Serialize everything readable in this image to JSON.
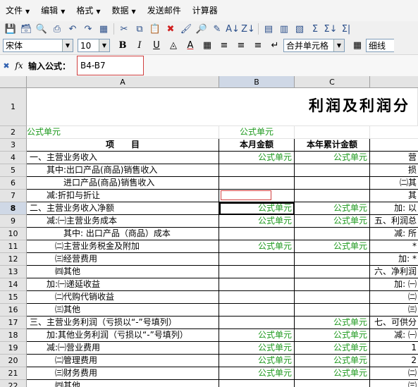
{
  "menubar": {
    "items": [
      {
        "label": "文件",
        "dropdown": true
      },
      {
        "label": "编辑",
        "dropdown": true
      },
      {
        "label": "格式",
        "dropdown": true
      },
      {
        "label": "数据",
        "dropdown": true
      },
      {
        "label": "发送邮件",
        "dropdown": false
      },
      {
        "label": "计算器",
        "dropdown": false
      }
    ]
  },
  "format": {
    "font": "宋体",
    "size": "10",
    "merge": "合并单元格",
    "border": "细线"
  },
  "formula": {
    "label": "输入公式：",
    "value": "B4-B7"
  },
  "grid": {
    "columns": [
      "A",
      "B",
      "C"
    ],
    "title": "利润及利润分",
    "rows": [
      {
        "n": "1",
        "a": "",
        "b": "",
        "c": "",
        "d": ""
      },
      {
        "n": "2",
        "a": "公式单元",
        "b": "公式单元",
        "c": "",
        "d": ""
      },
      {
        "n": "3",
        "a": "项　　目",
        "b": "本月金额",
        "c": "本年累计金额",
        "d": ""
      },
      {
        "n": "4",
        "a": "一、主营业务收入",
        "b": "公式单元",
        "c": "公式单元",
        "d": "营"
      },
      {
        "n": "5",
        "a": "　　其中:出口产品(商品)销售收入",
        "b": "",
        "c": "",
        "d": "损"
      },
      {
        "n": "6",
        "a": "　　　　进口产品(商品)销售收入",
        "b": "",
        "c": "",
        "d": "㈡其"
      },
      {
        "n": "7",
        "a": "　　减:折扣与折让",
        "b": "",
        "c": "",
        "d": "其"
      },
      {
        "n": "8",
        "a": "二、主营业务收入净额",
        "b": "公式单元",
        "c": "公式单元",
        "d": "加: 以"
      },
      {
        "n": "9",
        "a": "　　减:㈠主营业务成本",
        "b": "公式单元",
        "c": "公式单元",
        "d": "五、利润总"
      },
      {
        "n": "10",
        "a": "　　　　其中: 出口产品（商品）成本",
        "b": "",
        "c": "",
        "d": "减: 所"
      },
      {
        "n": "11",
        "a": "　　　㈡主营业务税金及附加",
        "b": "公式单元",
        "c": "公式单元",
        "d": "*"
      },
      {
        "n": "12",
        "a": "　　　㈢经营费用",
        "b": "",
        "c": "",
        "d": "加: *"
      },
      {
        "n": "13",
        "a": "　　　㈣其他",
        "b": "",
        "c": "",
        "d": "六、净利润"
      },
      {
        "n": "14",
        "a": "　　加:㈠递延收益",
        "b": "",
        "c": "",
        "d": "加: ㈠"
      },
      {
        "n": "15",
        "a": "　　　㈡代购代销收益",
        "b": "",
        "c": "",
        "d": "㈡"
      },
      {
        "n": "16",
        "a": "　　　㈢其他",
        "b": "",
        "c": "",
        "d": "㈢"
      },
      {
        "n": "17",
        "a": "三、主营业务利润（亏损以“-”号填列）",
        "b": "",
        "c": "公式单元",
        "d": "七、可供分"
      },
      {
        "n": "18",
        "a": "　　加:其他业务利润（亏损以“-”号填列）",
        "b": "公式单元",
        "c": "公式单元",
        "d": "减: ㈠"
      },
      {
        "n": "19",
        "a": "　　减:㈠营业费用",
        "b": "公式单元",
        "c": "公式单元",
        "d": "1"
      },
      {
        "n": "20",
        "a": "　　　㈡管理费用",
        "b": "公式单元",
        "c": "公式单元",
        "d": "2"
      },
      {
        "n": "21",
        "a": "　　　㈢财务费用",
        "b": "公式单元",
        "c": "公式单元",
        "d": "㈡"
      },
      {
        "n": "22",
        "a": "　　　㈣其他",
        "b": "",
        "c": "",
        "d": "㈢"
      }
    ]
  }
}
